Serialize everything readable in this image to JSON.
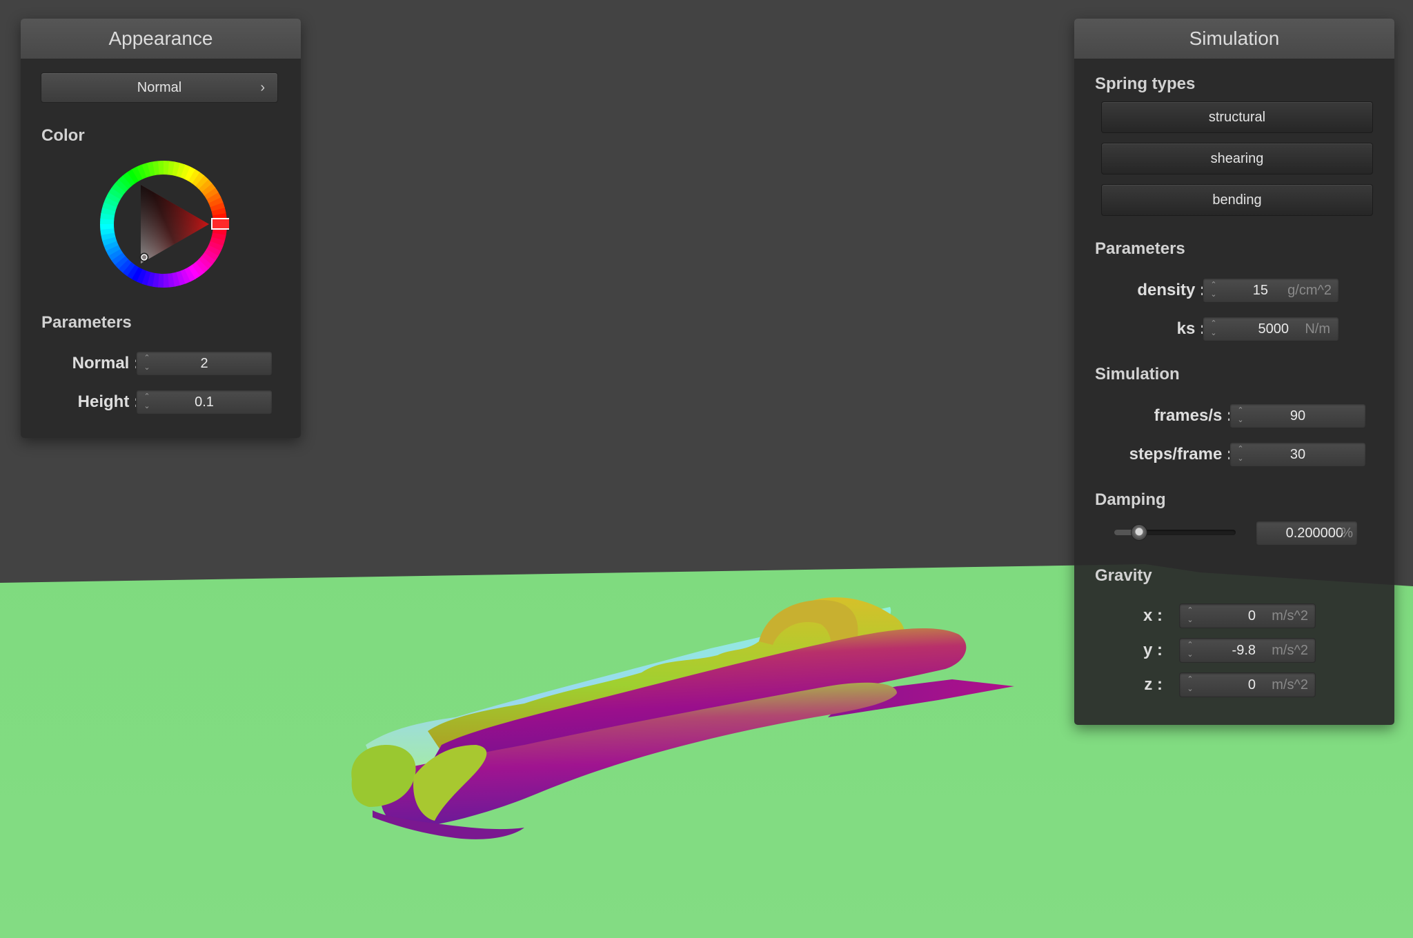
{
  "appearance_panel": {
    "title": "Appearance",
    "shader_popup": {
      "label": "Normal",
      "chevron": "›"
    },
    "color_section": "Color",
    "color_wheel": {
      "selected_hue": "red",
      "selected_color": "#ff1a1a"
    },
    "parameters_section": "Parameters",
    "normal_label": "Normal :",
    "normal_value": "2",
    "height_label": "Height :",
    "height_value": "0.1"
  },
  "simulation_panel": {
    "title": "Simulation",
    "spring_types_section": "Spring types",
    "spring_buttons": {
      "structural": "structural",
      "shearing": "shearing",
      "bending": "bending"
    },
    "parameters_section": "Parameters",
    "density_label": "density :",
    "density_value": "15",
    "density_unit": "g/cm^2",
    "ks_label": "ks :",
    "ks_value": "5000",
    "ks_unit": "N/m",
    "simulation_section": "Simulation",
    "fps_label": "frames/s :",
    "fps_value": "90",
    "steps_label": "steps/frame :",
    "steps_value": "30",
    "damping_section": "Damping",
    "damping_value": "0.200000",
    "damping_unit": "%",
    "damping_slider_fraction": 0.2,
    "gravity_section": "Gravity",
    "gx_label": "x :",
    "gx_value": "0",
    "gy_label": "y :",
    "gy_value": "-9.8",
    "gz_label": "z :",
    "gz_value": "0",
    "gravity_unit": "m/s^2"
  },
  "spinner_glyphs": {
    "up": "⌃",
    "down": "⌄"
  },
  "colors": {
    "background": "#434343",
    "floor": "#80db80",
    "panel": "#2a2a2a",
    "panel_header": "#4e4e4e",
    "cloth_magenta": "#a0108c",
    "cloth_yellow": "#b8b820",
    "cloth_cyan": "#80e0e0"
  }
}
